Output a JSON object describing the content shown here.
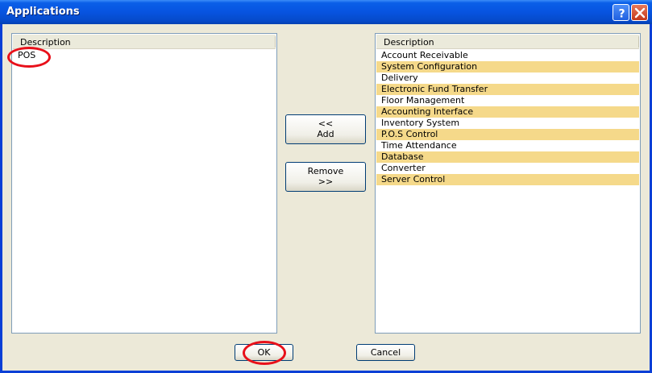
{
  "window": {
    "title": "Applications",
    "help_icon": "question-mark",
    "close_icon": "x",
    "titlebar_color": "#0754e0"
  },
  "left_list": {
    "header": "Description",
    "items": [
      "POS"
    ]
  },
  "right_list": {
    "header": "Description",
    "row_alt_color": "#f5d98a",
    "items": [
      "Account Receivable",
      "System Configuration",
      "Delivery",
      "Electronic Fund Transfer",
      "Floor Management",
      "Accounting Interface",
      "Inventory System",
      "P.O.S Control",
      "Time Attendance",
      "Database",
      "Converter",
      "Server Control"
    ]
  },
  "buttons": {
    "add_line1": "<<",
    "add_line2": "Add",
    "remove_line1": "Remove",
    "remove_line2": ">>",
    "ok": "OK",
    "cancel": "Cancel"
  },
  "annotations": {
    "highlight_color": "#e8101a"
  }
}
